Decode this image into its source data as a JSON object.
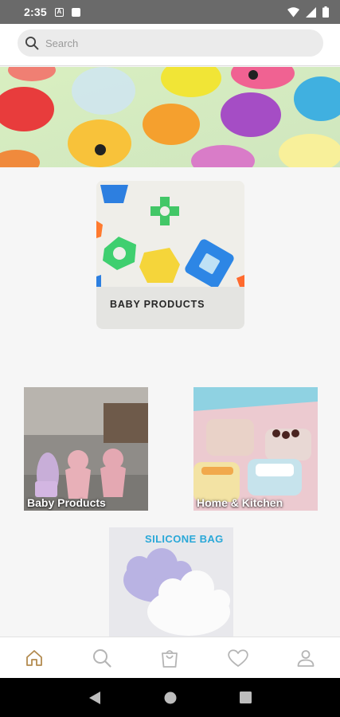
{
  "status_bar": {
    "time": "2:35",
    "a_icon_text": "A"
  },
  "search": {
    "placeholder": "Search",
    "value": ""
  },
  "featured": {
    "label": "BABY PRODUCTS"
  },
  "categories": [
    {
      "label": "Baby Products"
    },
    {
      "label": "Home & Kitchen"
    }
  ],
  "silicone": {
    "caption": "SILICONE BAG"
  },
  "bottom_nav": {
    "items": [
      "home-icon",
      "search-icon",
      "shopping-bag-icon",
      "heart-icon",
      "user-icon"
    ],
    "active_color": "#b28a4f",
    "inactive_color": "#b5b5b5"
  }
}
